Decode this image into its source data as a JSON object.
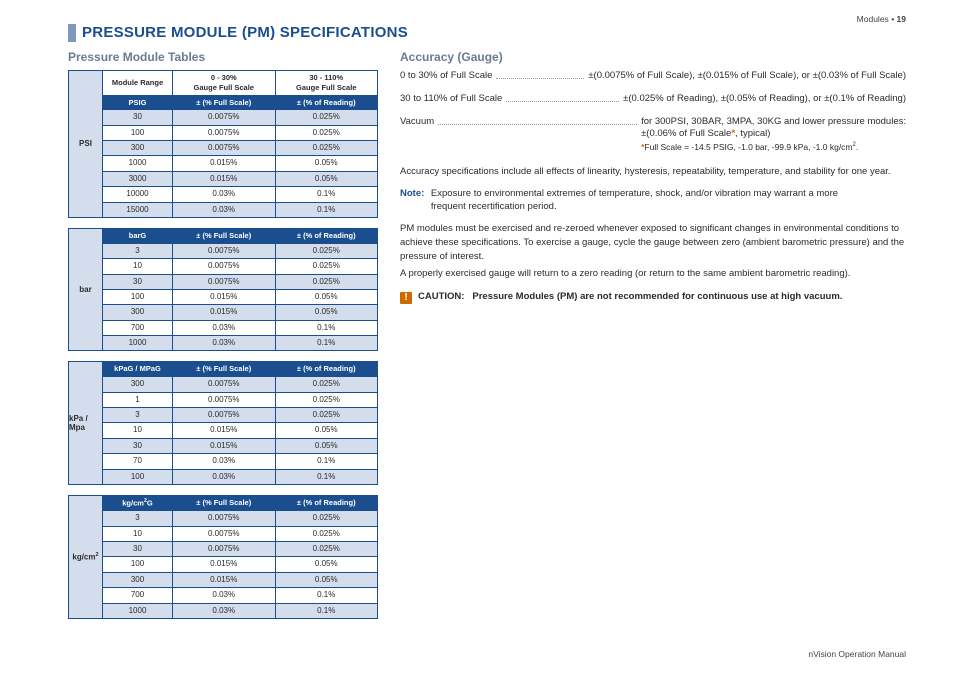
{
  "meta": {
    "crumb_left": "Modules",
    "page_num": "19",
    "footer": "nVision Operation Manual"
  },
  "page_title": "PRESSURE MODULE (PM) SPECIFICATIONS",
  "left": {
    "subtitle": "Pressure Module Tables",
    "first_table_head": {
      "c1": "Module Range",
      "c2": "0 - 30%\nGauge Full Scale",
      "c3": "30 - 110%\nGauge Full Scale"
    },
    "tables": [
      {
        "side": "PSI",
        "blue": {
          "c1": "PSIG",
          "c2": "± (% Full Scale)",
          "c3": "± (% of Reading)"
        },
        "rows": [
          [
            "30",
            "0.0075%",
            "0.025%"
          ],
          [
            "100",
            "0.0075%",
            "0.025%"
          ],
          [
            "300",
            "0.0075%",
            "0.025%"
          ],
          [
            "1000",
            "0.015%",
            "0.05%"
          ],
          [
            "3000",
            "0.015%",
            "0.05%"
          ],
          [
            "10000",
            "0.03%",
            "0.1%"
          ],
          [
            "15000",
            "0.03%",
            "0.1%"
          ]
        ]
      },
      {
        "side": "bar",
        "blue": {
          "c1": "barG",
          "c2": "± (% Full Scale)",
          "c3": "± (% of Reading)"
        },
        "rows": [
          [
            "3",
            "0.0075%",
            "0.025%"
          ],
          [
            "10",
            "0.0075%",
            "0.025%"
          ],
          [
            "30",
            "0.0075%",
            "0.025%"
          ],
          [
            "100",
            "0.015%",
            "0.05%"
          ],
          [
            "300",
            "0.015%",
            "0.05%"
          ],
          [
            "700",
            "0.03%",
            "0.1%"
          ],
          [
            "1000",
            "0.03%",
            "0.1%"
          ]
        ]
      },
      {
        "side": "kPa / Mpa",
        "blue": {
          "c1": "kPaG / MPaG",
          "c2": "± (% Full Scale)",
          "c3": "± (% of Reading)"
        },
        "rows": [
          [
            "300",
            "0.0075%",
            "0.025%"
          ],
          [
            "1",
            "0.0075%",
            "0.025%"
          ],
          [
            "3",
            "0.0075%",
            "0.025%"
          ],
          [
            "10",
            "0.015%",
            "0.05%"
          ],
          [
            "30",
            "0.015%",
            "0.05%"
          ],
          [
            "70",
            "0.03%",
            "0.1%"
          ],
          [
            "100",
            "0.03%",
            "0.1%"
          ]
        ]
      },
      {
        "side": "kg/cm²",
        "blue": {
          "c1": "kg/cm²G",
          "c2": "± (% Full Scale)",
          "c3": "± (% of Reading)"
        },
        "rows": [
          [
            "3",
            "0.0075%",
            "0.025%"
          ],
          [
            "10",
            "0.0075%",
            "0.025%"
          ],
          [
            "30",
            "0.0075%",
            "0.025%"
          ],
          [
            "100",
            "0.015%",
            "0.05%"
          ],
          [
            "300",
            "0.015%",
            "0.05%"
          ],
          [
            "700",
            "0.03%",
            "0.1%"
          ],
          [
            "1000",
            "0.03%",
            "0.1%"
          ]
        ]
      }
    ]
  },
  "right": {
    "subtitle": "Accuracy (Gauge)",
    "lines": [
      {
        "label": "0 to 30% of Full Scale",
        "value": "±(0.0075% of Full Scale), ±(0.015% of Full Scale), or ±(0.03% of Full Scale)"
      },
      {
        "label": "30 to 110% of Full Scale",
        "value": "±(0.025% of Reading), ±(0.05% of Reading), or ±(0.1% of Reading)"
      }
    ],
    "vacuum": {
      "label": "Vacuum",
      "line1": "for 300PSI, 30BAR, 3MPA, 30KG and lower pressure modules:",
      "line2_pre": "±(0.06% of Full Scale",
      "line2_post": ", typical)",
      "footnote_pre": "Full Scale = -14.5 PSIG, -1.0 bar, -99.9 kPa, -1.0 kg/cm",
      "footnote_sup": "2",
      "footnote_post": "."
    },
    "para1": "Accuracy specifications include all effects of linearity, hysteresis, repeatability, temperature, and stability for one year.",
    "note_label": "Note:",
    "note_text": "Exposure to environmental extremes of temperature, shock, and/or vibration may warrant a more frequent recertification period.",
    "para2": "PM modules must be exercised and re-zeroed whenever exposed to significant changes in environmental conditions to achieve these specifications. To exercise a gauge, cycle the gauge between zero (ambient barometric pressure) and the pressure of interest.",
    "para3": "A properly exercised gauge will return to a zero reading (or return to the same ambient barometric reading).",
    "caution_label": "CAUTION:",
    "caution_text": "Pressure Modules (PM) are not recommended for continuous use at high vacuum."
  }
}
